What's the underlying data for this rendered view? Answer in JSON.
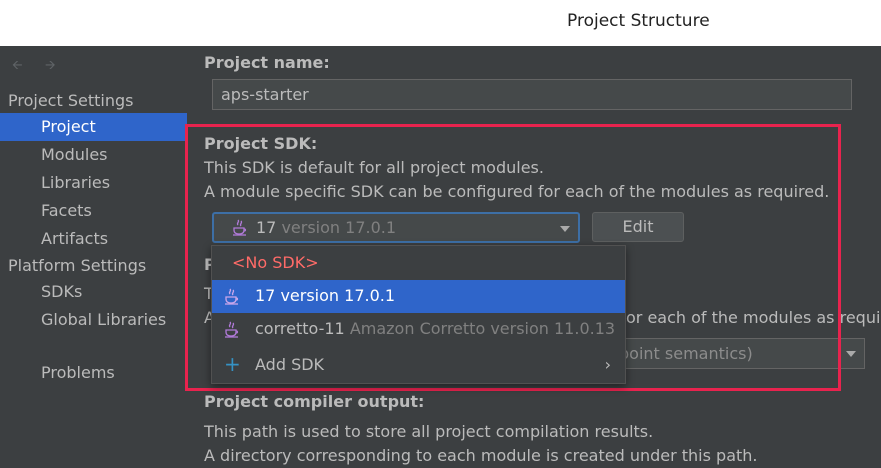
{
  "window": {
    "title": "Project Structure"
  },
  "nav": {
    "back_icon": "left-arrow-icon",
    "forward_icon": "right-arrow-icon"
  },
  "sidebar": {
    "project_settings_header": "Project Settings",
    "project_settings_items": [
      "Project",
      "Modules",
      "Libraries",
      "Facets",
      "Artifacts"
    ],
    "selected": "Project",
    "platform_settings_header": "Platform Settings",
    "platform_settings_items": [
      "SDKs",
      "Global Libraries"
    ],
    "problems": "Problems"
  },
  "main": {
    "project_name_label": "Project name:",
    "project_name_value": "aps-starter",
    "sdk_label": "Project SDK:",
    "sdk_desc_1": "This SDK is default for all project modules.",
    "sdk_desc_2": "A module specific SDK can be configured for each of the modules as required.",
    "sdk_selected_name": "17",
    "sdk_selected_version": "version 17.0.1",
    "edit_button": "Edit",
    "lang_label_partial": "P",
    "lang_desc_partial_1": "T",
    "lang_desc_partial_2": "A",
    "lang_desc_tail": "or each of the modules as requir",
    "lang_combo_partial": "point semantics)",
    "compiler_output_label": "Project compiler output:",
    "compiler_desc_1": "This path is used to store all project compilation results.",
    "compiler_desc_2": "A directory corresponding to each module is created under this path."
  },
  "sdk_popup": {
    "items": [
      {
        "label": "<No SDK>",
        "detail": ""
      },
      {
        "label": "17 version 17.0.1",
        "detail": ""
      },
      {
        "label": "corretto-11",
        "detail": "Amazon Corretto version 11.0.13"
      },
      {
        "label": "Add SDK",
        "detail": ""
      }
    ],
    "selected_index": 1
  },
  "colors": {
    "accent": "#2f65ca",
    "highlight_box": "#e8234e",
    "no_sdk": "#ff6b68"
  }
}
